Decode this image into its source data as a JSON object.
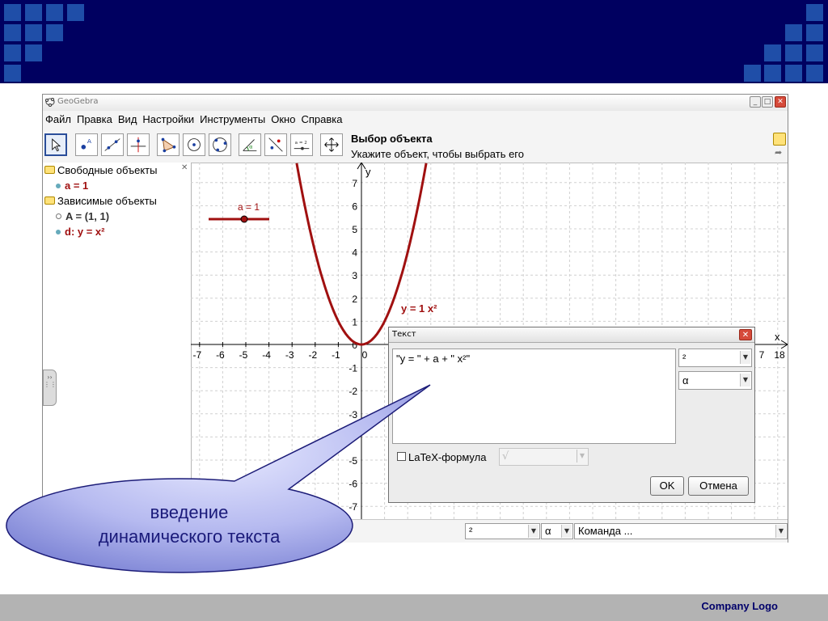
{
  "slide": {
    "company_logo": "Company  Logo"
  },
  "window": {
    "title": "GeoGebra"
  },
  "menu": [
    "Файл",
    "Правка",
    "Вид",
    "Настройки",
    "Инструменты",
    "Окно",
    "Справка"
  ],
  "toolbar": {
    "tool_name": "Выбор объекта",
    "tool_help": "Укажите объект, чтобы выбрать его"
  },
  "algebra": {
    "free_objects": "Свободные объекты",
    "free_items": [
      "a = 1"
    ],
    "dependent_objects": "Зависимые объекты",
    "dependent_items": [
      "A = (1, 1)",
      "d: y = x²"
    ]
  },
  "graphics": {
    "slider_label": "a = 1",
    "curve_label": "y = 1 x²",
    "axis_x_label": "x",
    "axis_y_label": "y",
    "x_ticks": [
      "-7",
      "-6",
      "-5",
      "-4",
      "-3",
      "-2",
      "-1",
      "0"
    ],
    "x_ticks_right": [
      "7",
      "18"
    ],
    "y_ticks_pos": [
      "7",
      "6",
      "5",
      "4",
      "3",
      "2",
      "1",
      "0"
    ],
    "y_ticks_neg": [
      "-1",
      "-2",
      "-3",
      "-5",
      "-6",
      "-7"
    ]
  },
  "text_dialog": {
    "title": "Текст",
    "content": "\"y = \" + a + \" x²\"",
    "symbol_select": "²",
    "greek_select": "α",
    "latex_label": "LaTeX-формула",
    "latex_combo": "√",
    "ok_label": "OK",
    "cancel_label": "Отмена"
  },
  "input_bar": {
    "symbol": "²",
    "greek": "α",
    "command": "Команда ..."
  },
  "callout": {
    "line1": "введение",
    "line2": "динамического текста"
  },
  "colors": {
    "banner": "#000060",
    "squares": "#1f4ea8",
    "curve": "#a01010",
    "callout": "#8f95e0"
  }
}
